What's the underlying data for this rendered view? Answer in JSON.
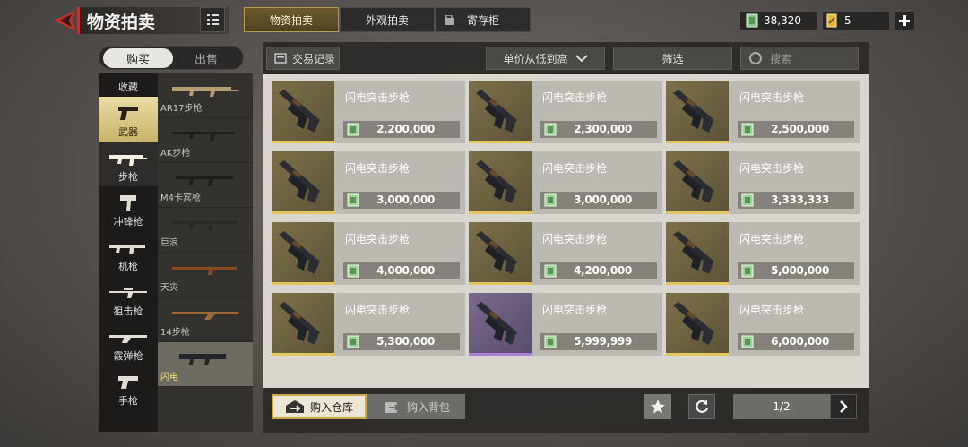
{
  "header": {
    "title": "物资拍卖",
    "tabs": [
      {
        "label": "物资拍卖",
        "active": true
      },
      {
        "label": "外观拍卖",
        "active": false
      },
      {
        "label": "寄存柜",
        "active": false
      }
    ],
    "currency1": "38,320",
    "currency2": "5",
    "accent_color": "#c8302c",
    "gold_color": "#e5c65c"
  },
  "buy_sell": {
    "buy": "购买",
    "sell": "出售"
  },
  "categories": [
    {
      "label": "收藏",
      "icon": "favorites-icon"
    },
    {
      "label": "武器",
      "icon": "pistol-icon",
      "active": true
    },
    {
      "label": "步枪",
      "icon": "rifle-icon"
    },
    {
      "label": "冲锋枪",
      "icon": "smg-icon"
    },
    {
      "label": "机枪",
      "icon": "machine-gun-icon"
    },
    {
      "label": "狙击枪",
      "icon": "sniper-icon"
    },
    {
      "label": "霰弹枪",
      "icon": "shotgun-icon"
    },
    {
      "label": "手枪",
      "icon": "handgun-icon"
    },
    {
      "label": "",
      "icon": "knife-icon"
    }
  ],
  "subtypes": [
    {
      "label": "AR17步枪"
    },
    {
      "label": "AK步枪"
    },
    {
      "label": "M4卡宾枪"
    },
    {
      "label": "巨浪"
    },
    {
      "label": "天灾"
    },
    {
      "label": "14步枪"
    },
    {
      "label": "闪电",
      "active": true
    }
  ],
  "toolbar": {
    "history": "交易记录",
    "sort": "单价从低到高",
    "filter": "筛选",
    "search_placeholder": "搜索"
  },
  "items": [
    {
      "name": "闪电突击步枪",
      "price": "2,200,000",
      "rarity": "gold"
    },
    {
      "name": "闪电突击步枪",
      "price": "2,300,000",
      "rarity": "gold"
    },
    {
      "name": "闪电突击步枪",
      "price": "2,500,000",
      "rarity": "gold"
    },
    {
      "name": "闪电突击步枪",
      "price": "3,000,000",
      "rarity": "gold"
    },
    {
      "name": "闪电突击步枪",
      "price": "3,000,000",
      "rarity": "gold"
    },
    {
      "name": "闪电突击步枪",
      "price": "3,333,333",
      "rarity": "gold"
    },
    {
      "name": "闪电突击步枪",
      "price": "4,000,000",
      "rarity": "gold"
    },
    {
      "name": "闪电突击步枪",
      "price": "4,200,000",
      "rarity": "gold"
    },
    {
      "name": "闪电突击步枪",
      "price": "5,000,000",
      "rarity": "gold"
    },
    {
      "name": "闪电突击步枪",
      "price": "5,300,000",
      "rarity": "gold"
    },
    {
      "name": "闪电突击步枪",
      "price": "5,999,999",
      "rarity": "purple"
    },
    {
      "name": "闪电突击步枪",
      "price": "6,000,000",
      "rarity": "gold"
    }
  ],
  "bottom": {
    "to_warehouse": "购入仓库",
    "to_backpack": "购入背包",
    "page": "1/2"
  }
}
